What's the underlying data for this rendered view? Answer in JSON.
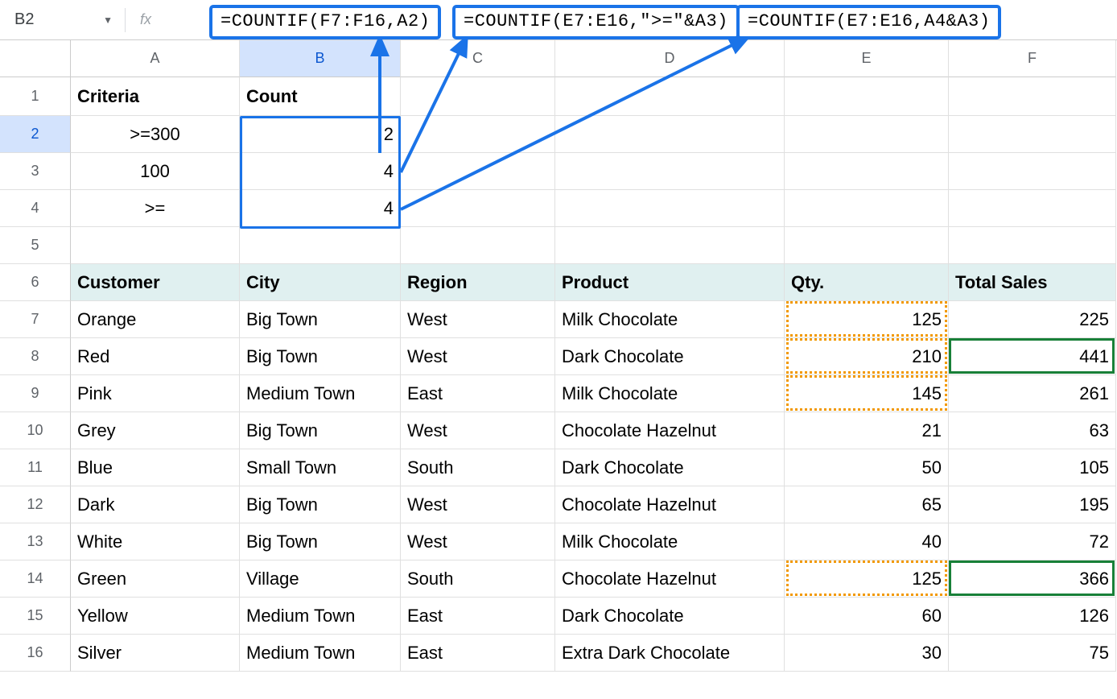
{
  "nameBox": "B2",
  "formulaBar": {
    "prefix": "=COUNTIF(",
    "range": "F7:F16",
    "sep": ",",
    "arg": "A2",
    "suffix": ")"
  },
  "callouts": {
    "f1": {
      "prefix": "=COUNTIF(",
      "range": "F7:F16",
      "arg1": "A2",
      "close": ")"
    },
    "f2": {
      "prefix": "=COUNTIF(",
      "range": "E7:E16",
      "str": "\">=\"",
      "amp": "&",
      "arg1": "A3",
      "close": ")"
    },
    "f3": {
      "prefix": "=COUNTIF(",
      "range": "E7:E16",
      "arg1": "A4",
      "amp": "&",
      "arg2": "A3",
      "close": ")"
    }
  },
  "columns": [
    "A",
    "B",
    "C",
    "D",
    "E",
    "F"
  ],
  "rows": [
    "1",
    "2",
    "3",
    "4",
    "5",
    "6",
    "7",
    "8",
    "9",
    "10",
    "11",
    "12",
    "13",
    "14",
    "15",
    "16"
  ],
  "criteriaHeader": {
    "a": "Criteria",
    "b": "Count"
  },
  "criteria": [
    {
      "a": ">=300",
      "b": "2"
    },
    {
      "a": "100",
      "b": "4"
    },
    {
      "a": ">=",
      "b": "4"
    }
  ],
  "tableHeader": {
    "a": "Customer",
    "b": "City",
    "c": "Region",
    "d": "Product",
    "e": "Qty.",
    "f": "Total Sales"
  },
  "data": [
    {
      "a": "Orange",
      "b": "Big Town",
      "c": "West",
      "d": "Milk Chocolate",
      "e": "125",
      "f": "225"
    },
    {
      "a": "Red",
      "b": "Big Town",
      "c": "West",
      "d": "Dark Chocolate",
      "e": "210",
      "f": "441"
    },
    {
      "a": "Pink",
      "b": "Medium Town",
      "c": "East",
      "d": "Milk Chocolate",
      "e": "145",
      "f": "261"
    },
    {
      "a": "Grey",
      "b": "Big Town",
      "c": "West",
      "d": "Chocolate Hazelnut",
      "e": "21",
      "f": "63"
    },
    {
      "a": "Blue",
      "b": "Small Town",
      "c": "South",
      "d": "Dark Chocolate",
      "e": "50",
      "f": "105"
    },
    {
      "a": "Dark",
      "b": "Big Town",
      "c": "West",
      "d": "Chocolate Hazelnut",
      "e": "65",
      "f": "195"
    },
    {
      "a": "White",
      "b": "Big Town",
      "c": "West",
      "d": "Milk Chocolate",
      "e": "40",
      "f": "72"
    },
    {
      "a": "Green",
      "b": "Village",
      "c": "South",
      "d": "Chocolate Hazelnut",
      "e": "125",
      "f": "366"
    },
    {
      "a": "Yellow",
      "b": "Medium Town",
      "c": "East",
      "d": "Dark Chocolate",
      "e": "60",
      "f": "126"
    },
    {
      "a": "Silver",
      "b": "Medium Town",
      "c": "East",
      "d": "Extra Dark Chocolate",
      "e": "30",
      "f": "75"
    }
  ]
}
